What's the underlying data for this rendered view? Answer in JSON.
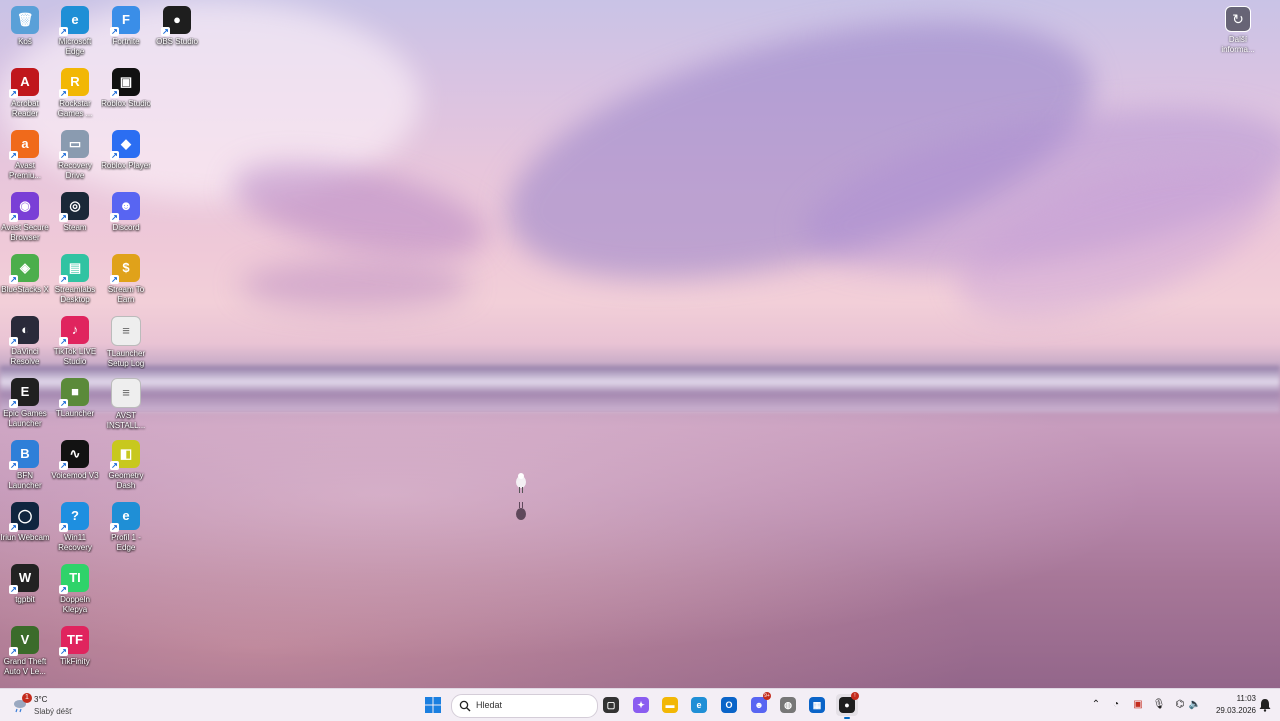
{
  "desktop": {
    "icons": [
      {
        "id": "kos",
        "label": "Koš",
        "glyph": "🗑",
        "color": "#5aa0d8",
        "shortcut": false
      },
      {
        "id": "edge",
        "label": "Microsoft Edge",
        "glyph": "e",
        "color": "#1f8fd6",
        "shortcut": true
      },
      {
        "id": "fortnite",
        "label": "Fortnite",
        "glyph": "F",
        "color": "#3a8ee8",
        "shortcut": true
      },
      {
        "id": "obs",
        "label": "OBS Studio",
        "glyph": "●",
        "color": "#1e1e1e",
        "shortcut": true
      },
      {
        "id": "acrobat",
        "label": "Acrobat Reader",
        "glyph": "A",
        "color": "#c0171c",
        "shortcut": true
      },
      {
        "id": "rockstar",
        "label": "Rockstar Games ...",
        "glyph": "R",
        "color": "#f2b705",
        "shortcut": true
      },
      {
        "id": "roblox-studio",
        "label": "Roblox Studio",
        "glyph": "▣",
        "color": "#111111",
        "shortcut": true
      },
      {
        "id": "avast-premium",
        "label": "Avast Premiu...",
        "glyph": "a",
        "color": "#f06a1b",
        "shortcut": true
      },
      {
        "id": "recovery-drive",
        "label": "Recovery Drive",
        "glyph": "▭",
        "color": "#8a9bb0",
        "shortcut": true
      },
      {
        "id": "roblox-player",
        "label": "Roblox Player",
        "glyph": "◆",
        "color": "#2b6ef2",
        "shortcut": true
      },
      {
        "id": "avast-browser",
        "label": "Avast Secure Browser",
        "glyph": "◉",
        "color": "#7a3fd6",
        "shortcut": true
      },
      {
        "id": "steam",
        "label": "Steam",
        "glyph": "◎",
        "color": "#1b2838",
        "shortcut": true
      },
      {
        "id": "discord",
        "label": "Discord",
        "glyph": "☻",
        "color": "#5865f2",
        "shortcut": true
      },
      {
        "id": "bluestacks",
        "label": "BlueStacks X",
        "glyph": "◈",
        "color": "#4cae4c",
        "shortcut": true
      },
      {
        "id": "streamlabs",
        "label": "Streamlabs Desktop",
        "glyph": "▤",
        "color": "#31c3a2",
        "shortcut": true
      },
      {
        "id": "stream-to-earn",
        "label": "Stream To Earn",
        "glyph": "$",
        "color": "#e0a21a",
        "shortcut": true
      },
      {
        "id": "davinci",
        "label": "DaVinci Resolve",
        "glyph": "◐",
        "color": "#2a2a3a",
        "shortcut": true
      },
      {
        "id": "tiktok-live",
        "label": "TikTok LIVE Studio",
        "glyph": "♪",
        "color": "#e0245e",
        "shortcut": true
      },
      {
        "id": "tlauncher-log",
        "label": "TLauncher Setup Log",
        "glyph": "≡",
        "color": "#eeeeee",
        "shortcut": false
      },
      {
        "id": "epic",
        "label": "Epic Games Launcher",
        "glyph": "E",
        "color": "#202020",
        "shortcut": true
      },
      {
        "id": "tlauncher",
        "label": "TLauncher",
        "glyph": "■",
        "color": "#5b8a3a",
        "shortcut": true
      },
      {
        "id": "avst-install",
        "label": "AVST INSTALL...",
        "glyph": "≡",
        "color": "#eeeeee",
        "shortcut": false
      },
      {
        "id": "bfn",
        "label": "BFN Launcher",
        "glyph": "B",
        "color": "#2f7fd8",
        "shortcut": true
      },
      {
        "id": "voicemod",
        "label": "Voicemod V3",
        "glyph": "∿",
        "color": "#121212",
        "shortcut": true
      },
      {
        "id": "geometry-dash",
        "label": "Geometry Dash",
        "glyph": "◧",
        "color": "#c8c81e",
        "shortcut": true
      },
      {
        "id": "iriun",
        "label": "Iriun Webcam",
        "glyph": "◯",
        "color": "#10253f",
        "shortcut": true
      },
      {
        "id": "win11-recovery",
        "label": "Win11 Recovery",
        "glyph": "?",
        "color": "#1e8fe0",
        "shortcut": true
      },
      {
        "id": "edge-profile",
        "label": "Profil 1 - Edge",
        "glyph": "e",
        "color": "#1f8fd6",
        "shortcut": true
      },
      {
        "id": "tgpbit",
        "label": "tgpbit",
        "glyph": "W",
        "color": "#222222",
        "shortcut": true
      },
      {
        "id": "typeit",
        "label": "Doppeln Klepya",
        "glyph": "TI",
        "color": "#2fd36a",
        "shortcut": true
      },
      {
        "id": "gta5",
        "label": "Grand Theft Auto V Le...",
        "glyph": "V",
        "color": "#3b6b2a",
        "shortcut": true
      },
      {
        "id": "tikfinity",
        "label": "TikFinity",
        "glyph": "TF",
        "color": "#e0245e",
        "shortcut": true
      }
    ],
    "widget": {
      "label": "Další informa...",
      "glyph": "↻"
    }
  },
  "taskbar": {
    "weather": {
      "temp": "3°C",
      "condition": "Slabý déšť",
      "badge": "1"
    },
    "search": {
      "placeholder": "Hledat"
    },
    "apps": [
      {
        "id": "task-view",
        "glyph": "▢",
        "color": "#333333"
      },
      {
        "id": "copilot",
        "glyph": "✦",
        "color": "#8a5cf0"
      },
      {
        "id": "file-explorer",
        "glyph": "▬",
        "color": "#f2b705"
      },
      {
        "id": "edge",
        "glyph": "e",
        "color": "#1f8fd6"
      },
      {
        "id": "outlook",
        "glyph": "O",
        "color": "#0a64c8"
      },
      {
        "id": "discord",
        "glyph": "☻",
        "color": "#5865f2",
        "badge": "9+"
      },
      {
        "id": "mouse-app",
        "glyph": "◍",
        "color": "#777777"
      },
      {
        "id": "store",
        "glyph": "▦",
        "color": "#0a64c8"
      },
      {
        "id": "obs",
        "glyph": "●",
        "color": "#1e1e1e",
        "badge": "!"
      }
    ],
    "clock": {
      "time": "11:03",
      "date": "29.03.2026"
    }
  }
}
